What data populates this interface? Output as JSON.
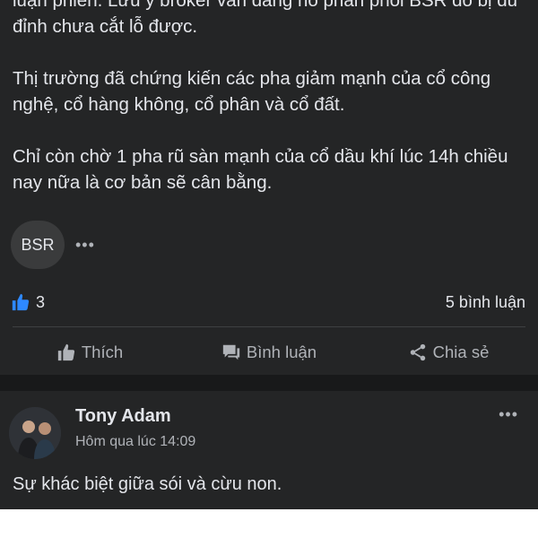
{
  "post": {
    "paragraphs": [
      "luận phiên. Lưu ý broker vẫn đang hô phân phối BSR do bị đu đỉnh chưa cắt lỗ được.",
      "Thị trường đã chứng kiến các pha giảm mạnh của cổ công nghệ, cổ hàng không, cổ phân và cổ đất.",
      "Chỉ còn chờ 1 pha rũ sàn mạnh của cổ dầu khí lúc 14h chiều nay nữa là cơ bản sẽ cân bằng."
    ],
    "tag": "BSR",
    "more_dots": "•••",
    "like_count": "3",
    "comment_count": "5 bình luận",
    "like_icon": "thumbs-up-icon",
    "accent_color": "#2e89ff"
  },
  "actions": {
    "like": {
      "label": "Thích",
      "icon": "thumbs-up-icon"
    },
    "comment": {
      "label": "Bình luận",
      "icon": "comment-icon"
    },
    "share": {
      "label": "Chia sẻ",
      "icon": "share-icon"
    }
  },
  "comment": {
    "author": "Tony Adam",
    "time": "Hôm qua lúc 14:09",
    "more_dots": "•••",
    "text": "Sự khác biệt giữa sói và cừu non."
  }
}
